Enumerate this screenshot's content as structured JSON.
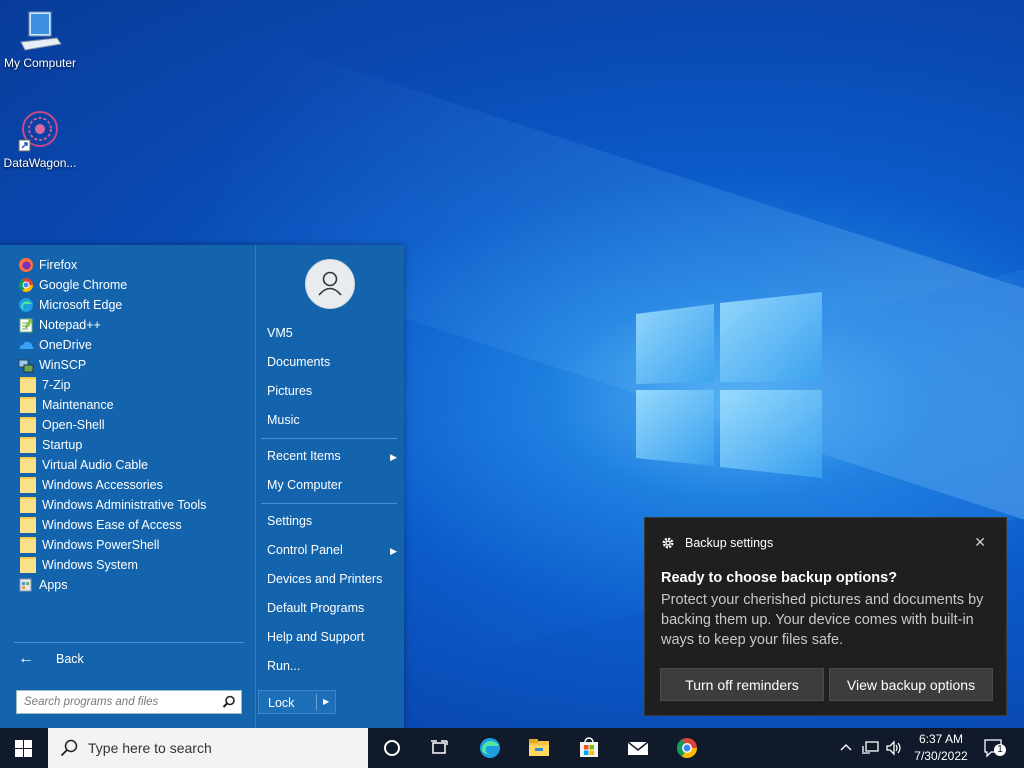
{
  "desktop": {
    "icons": [
      {
        "label": "My Computer",
        "icon": "computer-icon"
      },
      {
        "label": "DataWagon...",
        "icon": "datawagon-shortcut-icon"
      }
    ]
  },
  "start_menu": {
    "programs": [
      {
        "label": "Firefox",
        "icon": "firefox-icon"
      },
      {
        "label": "Google Chrome",
        "icon": "chrome-icon"
      },
      {
        "label": "Microsoft Edge",
        "icon": "edge-icon"
      },
      {
        "label": "Notepad++",
        "icon": "notepadpp-icon"
      },
      {
        "label": "OneDrive",
        "icon": "onedrive-icon"
      },
      {
        "label": "WinSCP",
        "icon": "winscp-icon"
      },
      {
        "label": "7-Zip",
        "icon": "folder-icon"
      },
      {
        "label": "Maintenance",
        "icon": "folder-icon"
      },
      {
        "label": "Open-Shell",
        "icon": "folder-icon"
      },
      {
        "label": "Startup",
        "icon": "folder-icon"
      },
      {
        "label": "Virtual Audio Cable",
        "icon": "folder-icon"
      },
      {
        "label": "Windows Accessories",
        "icon": "folder-icon"
      },
      {
        "label": "Windows Administrative Tools",
        "icon": "folder-icon"
      },
      {
        "label": "Windows Ease of Access",
        "icon": "folder-icon"
      },
      {
        "label": "Windows PowerShell",
        "icon": "folder-icon"
      },
      {
        "label": "Windows System",
        "icon": "folder-icon"
      },
      {
        "label": "Apps",
        "icon": "apps-icon"
      }
    ],
    "back_label": "Back",
    "search_placeholder": "Search programs and files",
    "right_items": [
      {
        "label": "VM5",
        "submenu": false
      },
      {
        "label": "Documents",
        "submenu": false
      },
      {
        "label": "Pictures",
        "submenu": false
      },
      {
        "label": "Music",
        "submenu": false
      },
      {
        "label": "Recent Items",
        "submenu": true
      },
      {
        "label": "My Computer",
        "submenu": false
      },
      {
        "label": "Settings",
        "submenu": false
      },
      {
        "label": "Control Panel",
        "submenu": true
      },
      {
        "label": "Devices and Printers",
        "submenu": false
      },
      {
        "label": "Default Programs",
        "submenu": false
      },
      {
        "label": "Help and Support",
        "submenu": false
      },
      {
        "label": "Run...",
        "submenu": false
      }
    ],
    "lock_label": "Lock"
  },
  "toast": {
    "app_name": "Backup settings",
    "title": "Ready to choose backup options?",
    "body": "Protect your cherished pictures and documents by backing them up. Your device comes with built-in ways to keep your files safe.",
    "button_left": "Turn off reminders",
    "button_right": "View backup options"
  },
  "taskbar": {
    "search_placeholder": "Type here to search",
    "time": "6:37 AM",
    "date": "7/30/2022",
    "notification_count": "1"
  },
  "colors": {
    "start_bg": "#1364ac",
    "toast_bg": "#1f1f1f",
    "taskbar_bg": "#101a2a"
  }
}
